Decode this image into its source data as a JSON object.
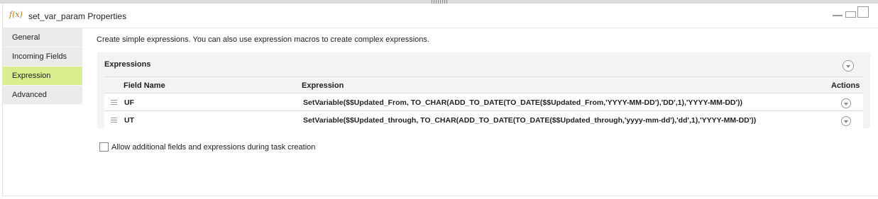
{
  "window": {
    "fx_icon": "f(x)",
    "title": "set_var_param Properties"
  },
  "nav": {
    "items": [
      {
        "label": "General",
        "active": false
      },
      {
        "label": "Incoming Fields",
        "active": false
      },
      {
        "label": "Expression",
        "active": true
      },
      {
        "label": "Advanced",
        "active": false
      }
    ]
  },
  "description": "Create simple expressions. You can also use expression macros to create complex expressions.",
  "expressions": {
    "title": "Expressions",
    "columns": {
      "field_name": "Field Name",
      "expression": "Expression",
      "actions": "Actions"
    },
    "rows": [
      {
        "field": "UF",
        "expression": "SetVariable($$Updated_From,  TO_CHAR(ADD_TO_DATE(TO_DATE($$Updated_From,'YYYY-MM-DD'),'DD',1),'YYYY-MM-DD'))"
      },
      {
        "field": "UT",
        "expression": "SetVariable($$Updated_through, TO_CHAR(ADD_TO_DATE(TO_DATE($$Updated_through,'yyyy-mm-dd'),'dd',1),'YYYY-MM-DD'))"
      }
    ]
  },
  "allow_additional": {
    "label": "Allow additional fields and expressions during task creation",
    "checked": false
  },
  "colors": {
    "active_nav": "#d9ee8f",
    "nav_bg": "#ebebeb",
    "section_bg": "#f3f3f3"
  }
}
